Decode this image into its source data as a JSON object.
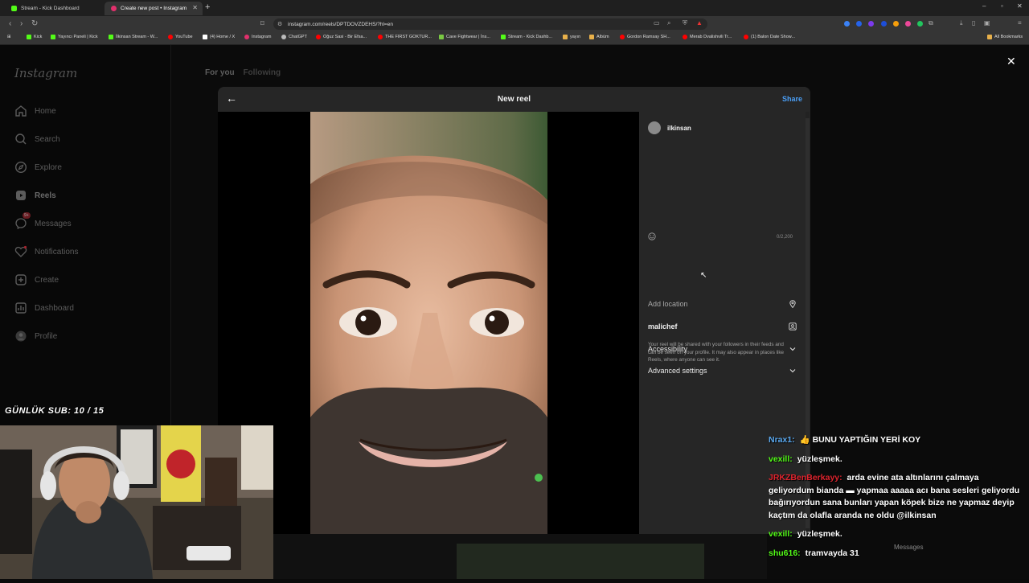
{
  "browser": {
    "tabs": [
      {
        "title": "Stream - Kick Dashboard",
        "active": false,
        "favicon_color": "#53fc18"
      },
      {
        "title": "Create new post • Instagram",
        "active": true,
        "favicon_color": "#e1306c"
      }
    ],
    "url": "instagram.com/reels/DPTDOVZDEHS/?hl=en",
    "bookmarks": [
      {
        "label": "Kick",
        "color": "#53fc18"
      },
      {
        "label": "Yayıncı Paneli | Kick",
        "color": "#53fc18"
      },
      {
        "label": "İlkinsan Stream - W...",
        "color": "#53fc18"
      },
      {
        "label": "YouTube",
        "color": "#ff0000"
      },
      {
        "label": "(4) Home / X",
        "color": "#ffffff"
      },
      {
        "label": "Instagram",
        "color": "#e1306c"
      },
      {
        "label": "ChatGPT",
        "color": "#bbbbbb"
      },
      {
        "label": "Oğuz Sasi - Bir Efsa...",
        "color": "#ff0000"
      },
      {
        "label": "THE FIRST GOKTUR...",
        "color": "#ff0000"
      },
      {
        "label": "Cave Fightwear | İns...",
        "color": "#7ac943"
      },
      {
        "label": "Stream - Kick Dashb...",
        "color": "#53fc18"
      },
      {
        "label": "yayın",
        "color": "#e8b04a"
      },
      {
        "label": "Albüm",
        "color": "#e8b04a"
      },
      {
        "label": "Gordon Ramsay SH...",
        "color": "#ff0000"
      },
      {
        "label": "Merab Dvalishvili Tr...",
        "color": "#ff0000"
      },
      {
        "label": "(1) Balon Date Show...",
        "color": "#ff0000"
      },
      {
        "label": "All Bookmarks",
        "color": "#e8b04a"
      }
    ]
  },
  "instagram": {
    "logo": "Instagram",
    "nav": [
      {
        "label": "Home",
        "icon": "home-icon"
      },
      {
        "label": "Search",
        "icon": "search-icon"
      },
      {
        "label": "Explore",
        "icon": "compass-icon"
      },
      {
        "label": "Reels",
        "icon": "reels-icon"
      },
      {
        "label": "Messages",
        "icon": "messenger-icon",
        "badge": "9+"
      },
      {
        "label": "Notifications",
        "icon": "heart-icon"
      },
      {
        "label": "Create",
        "icon": "plus-square-icon"
      },
      {
        "label": "Dashboard",
        "icon": "chart-icon"
      },
      {
        "label": "Profile",
        "icon": "profile-icon"
      }
    ],
    "feed_tabs": {
      "for_you": "For you",
      "following": "Following"
    },
    "modal": {
      "title": "New reel",
      "share": "Share",
      "username": "ilkinsan",
      "caption_counter": "0/2,200",
      "add_location": "Add location",
      "collaborator": "malichef",
      "accessibility": "Accessibility",
      "advanced_settings": "Advanced settings",
      "note": "Your reel will be shared with your followers in their feeds and can be seen on your profile. It may also appear in places like Reels, where anyone can see it."
    }
  },
  "stream": {
    "sub_goal": "GÜNLÜK SUB: 10 / 15",
    "chat": [
      {
        "user": "Nrax1:",
        "color": "#5aa9f0",
        "text": "👍 BUNU YAPTIĞIN YERİ KOY"
      },
      {
        "user": "vexill:",
        "color": "#53fc18",
        "text": "yüzleşmek."
      },
      {
        "user": "JRKZBenBerkayy:",
        "color": "#e0242e",
        "text": "arda evine ata altınlarını çalmaya geliyordum bianda ▬ yapmaa aaaaa acı bana sesleri geliyordu bağırıyordun sana bunları yapan köpek bize ne yapmaz deyip kaçtım da olafla aranda ne oldu @ilkinsan"
      },
      {
        "user": "vexill:",
        "color": "#53fc18",
        "text": "yüzleşmek."
      },
      {
        "user": "shu616:",
        "color": "#53fc18",
        "text": "tramvayda 31"
      }
    ],
    "ghost_messages": "Messages"
  }
}
